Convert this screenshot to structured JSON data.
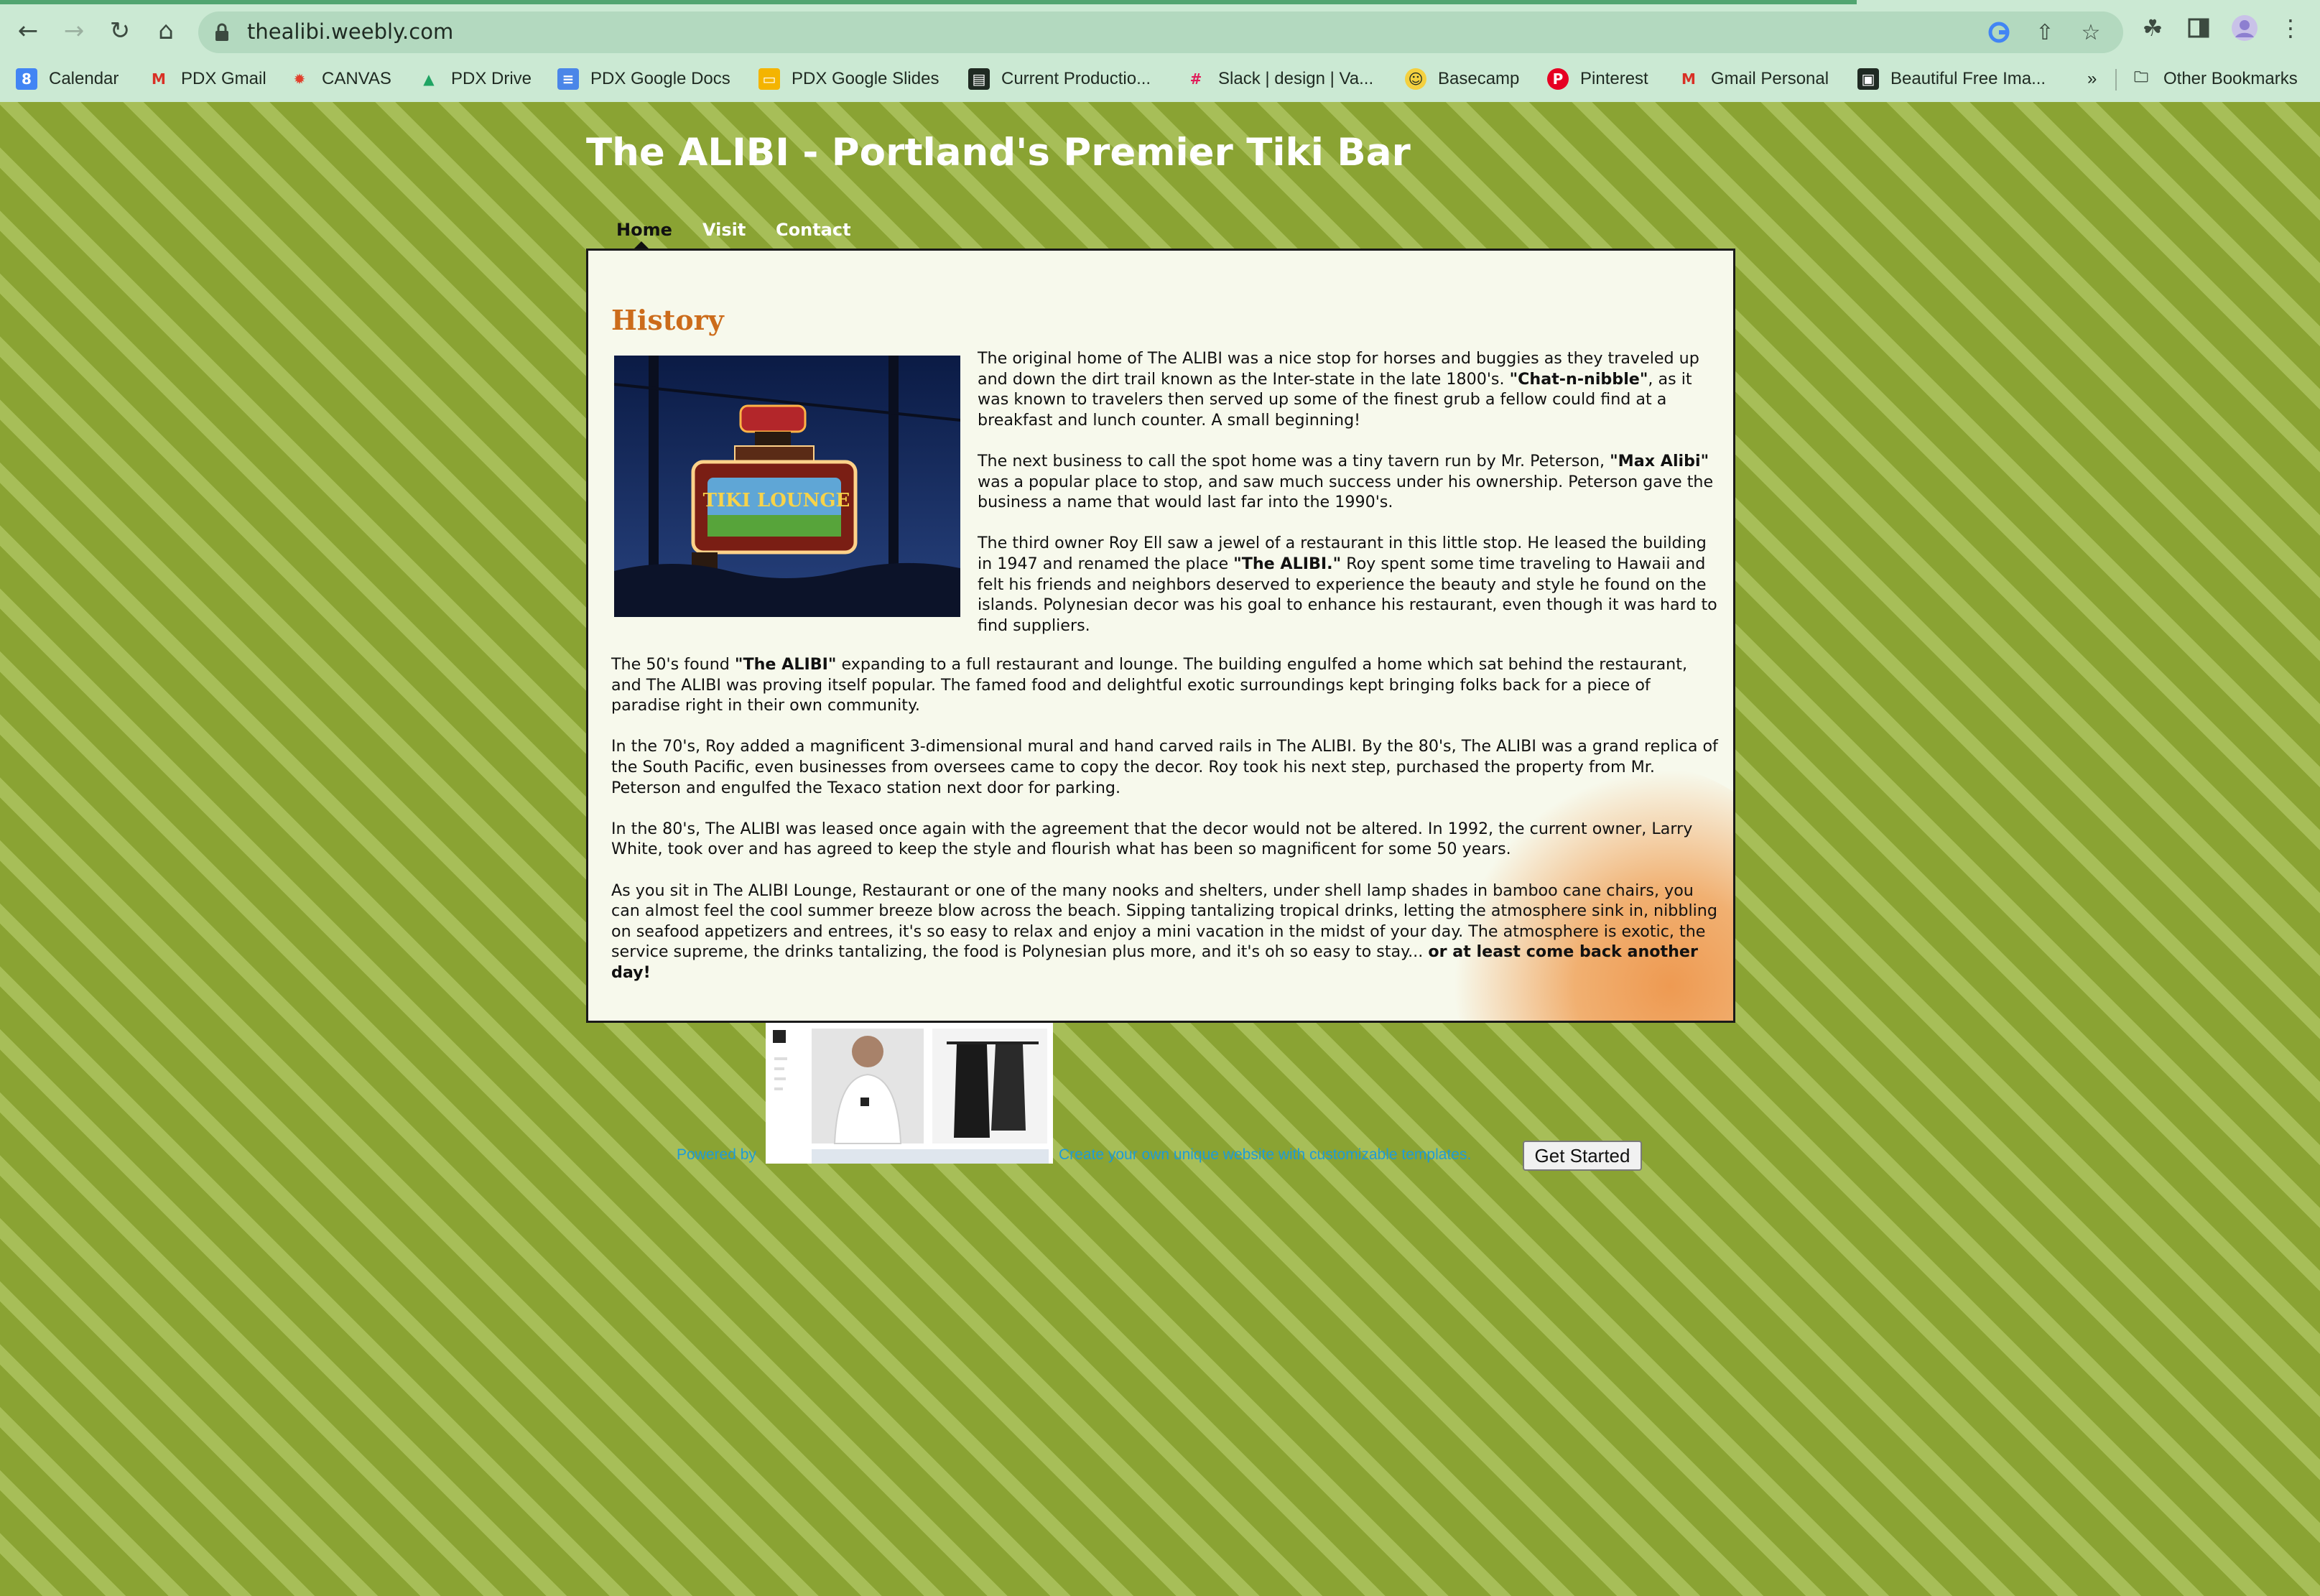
{
  "browser": {
    "url": "thealibi.weebly.com",
    "bookmarks": [
      {
        "label": "Calendar",
        "icon": "calendar-icon"
      },
      {
        "label": "PDX Gmail",
        "icon": "gmail-icon"
      },
      {
        "label": "CANVAS",
        "icon": "canvas-icon"
      },
      {
        "label": "PDX Drive",
        "icon": "drive-icon"
      },
      {
        "label": "PDX Google Docs",
        "icon": "docs-icon"
      },
      {
        "label": "PDX Google Slides",
        "icon": "slides-icon"
      },
      {
        "label": "Current Productio...",
        "icon": "trello-icon"
      },
      {
        "label": "Slack | design | Va...",
        "icon": "slack-icon"
      },
      {
        "label": "Basecamp",
        "icon": "basecamp-icon"
      },
      {
        "label": "Pinterest",
        "icon": "pinterest-icon"
      },
      {
        "label": "Gmail Personal",
        "icon": "gmail-icon"
      },
      {
        "label": "Beautiful Free Ima...",
        "icon": "unsplash-icon"
      }
    ],
    "overflow_label": "»",
    "other_bookmarks": "Other Bookmarks"
  },
  "site": {
    "title": "The ALIBI - Portland's Premier Tiki Bar",
    "nav": [
      "Home",
      "Visit",
      "Contact"
    ],
    "active_nav": "Home",
    "heading": "History",
    "photo_alt": "Tiki Lounge neon sign at night",
    "sign_text": "TIKI LOUNGE",
    "paragraphs": {
      "p1_a": "The original home of The ALIBI was a nice stop for horses and buggies as they traveled up and down the dirt trail known as the Inter-state in the late 1800's. ",
      "p1_b": "\"Chat-n-nibble\"",
      "p1_c": ", as it was known to travelers then served up some of the finest grub a fellow could find at a breakfast and lunch counter. A small beginning!",
      "p2_a": "The next business to call the spot home was a tiny tavern run by Mr. Peterson, ",
      "p2_b": "\"Max Alibi\"",
      "p2_c": " was a popular place to stop, and saw much success under his ownership. Peterson gave the business a name that would last far into the 1990's.",
      "p3_a": "The third owner Roy Ell saw a jewel of a restaurant in this little stop. He leased the building in 1947 and renamed the place ",
      "p3_b": "\"The ALIBI.\"",
      "p3_c": " Roy spent some time traveling to Hawaii and felt his friends and neighbors deserved to experience the beauty and style he found on the islands. Polynesian decor was his goal to enhance his restaurant, even though it was hard to find suppliers.",
      "p4_a": "The 50's found ",
      "p4_b": "\"The ALIBI\"",
      "p4_c": " expanding to a full restaurant and lounge. The building engulfed a home which sat behind the restaurant, and The ALIBI was proving itself popular. The famed food and delightful exotic surroundings kept bringing folks back for a piece of paradise right in their own community.",
      "p5": "In the 70's, Roy added a magnificent 3-dimensional mural and hand carved rails in The ALIBI. By the 80's, The ALIBI was a grand replica of the South Pacific, even businesses from oversees came to copy the decor. Roy took his next step, purchased the property from Mr. Peterson and engulfed the Texaco station next door for parking.",
      "p6": "In the 80's, The ALIBI was leased once again with the agreement that the decor would not be altered. In 1992, the current owner, Larry White, took over and has agreed to keep the style and flourish what has been so magnificent for some 50 years.",
      "p7_a": "As you sit in The ALIBI Lounge, Restaurant or one of the many nooks and shelters, under shell lamp shades in bamboo cane chairs, you can almost feel the cool summer breeze blow across the beach. Sipping tantalizing tropical drinks, letting the atmosphere sink in, nibbling on seafood appetizers and entrees, it's so easy to relax and enjoy a mini vacation in the midst of your day. The atmosphere is exotic, the service supreme, the drinks tantalizing, the food is Polynesian plus more, and it's oh so easy to stay... ",
      "p7_b": "or at least come back another day!"
    }
  },
  "footer": {
    "powered_by": "Powered by",
    "promo": "Create your own unique website with customizable templates.",
    "cta": "Get Started"
  },
  "colors": {
    "page_bg": "#8aa33a",
    "heading": "#cc6c1b",
    "content_bg": "#f7f9ec",
    "footer_link": "#1e9bd7"
  }
}
